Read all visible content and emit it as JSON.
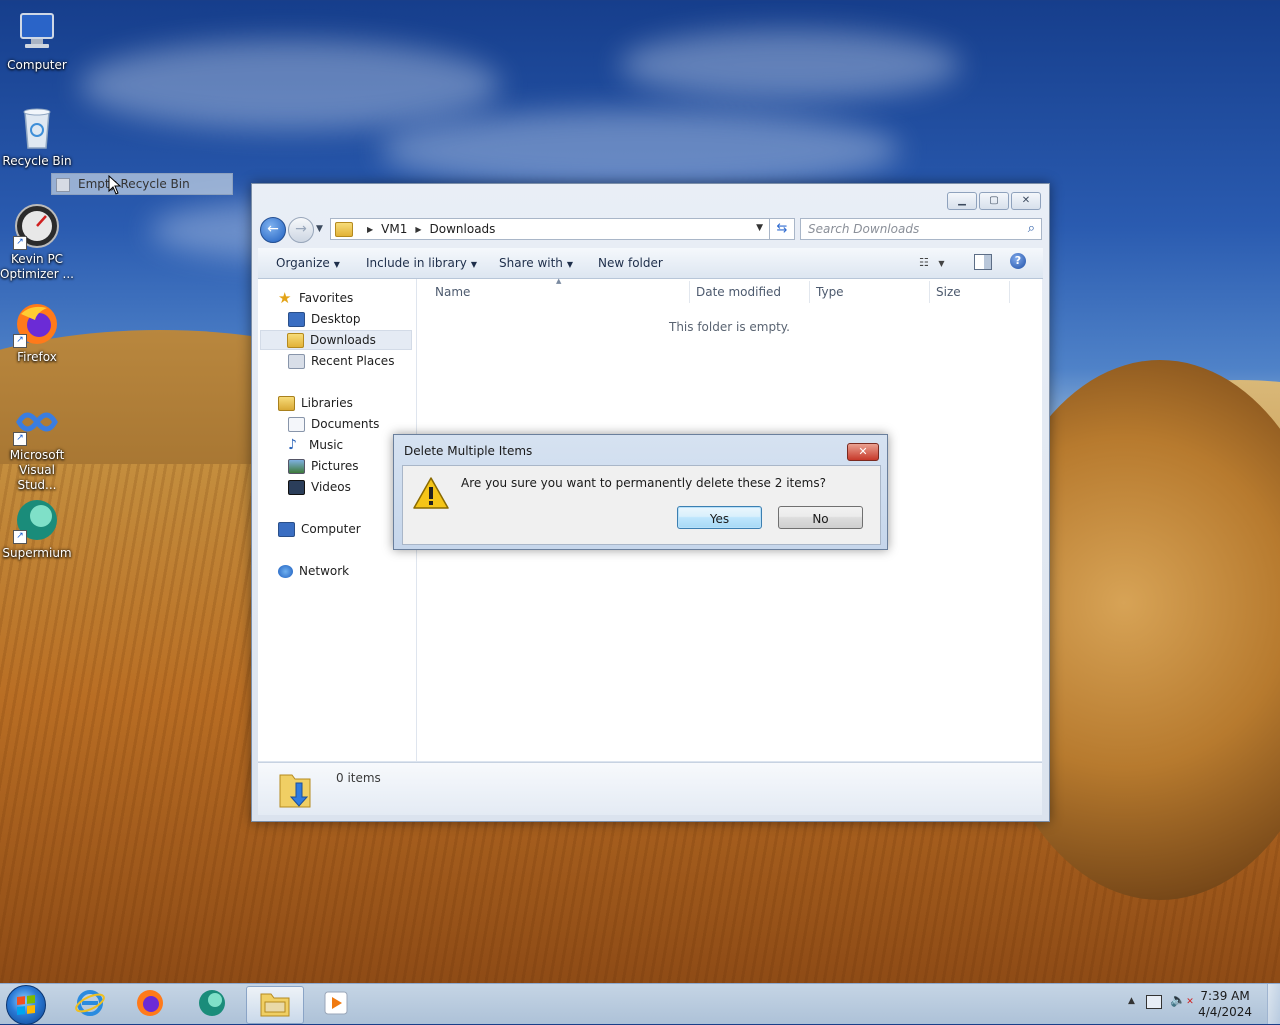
{
  "desktop": {
    "icons": [
      {
        "label": "Computer"
      },
      {
        "label": "Recycle Bin"
      },
      {
        "label": "Kevin PC Optimizer ..."
      },
      {
        "label": "Firefox"
      },
      {
        "label": "Microsoft Visual Stud..."
      },
      {
        "label": "Supermium"
      }
    ],
    "drag_label": "Empty Recycle Bin"
  },
  "explorer": {
    "breadcrumb": [
      "VM1",
      "Downloads"
    ],
    "search_placeholder": "Search Downloads",
    "toolbar": {
      "organize": "Organize",
      "include_in_library": "Include in library",
      "share_with": "Share with",
      "new_folder": "New folder"
    },
    "nav": {
      "favorites": "Favorites",
      "desktop": "Desktop",
      "downloads": "Downloads",
      "recent_places": "Recent Places",
      "libraries": "Libraries",
      "documents": "Documents",
      "music": "Music",
      "pictures": "Pictures",
      "videos": "Videos",
      "computer": "Computer",
      "network": "Network"
    },
    "columns": {
      "name": "Name",
      "date_modified": "Date modified",
      "type": "Type",
      "size": "Size"
    },
    "empty_message": "This folder is empty.",
    "item_count": "0 items"
  },
  "dialog": {
    "title": "Delete Multiple Items",
    "message": "Are you sure you want to permanently delete these 2 items?",
    "yes": "Yes",
    "no": "No"
  },
  "taskbar": {
    "apps": [
      "internet-explorer",
      "firefox",
      "supermium",
      "windows-explorer",
      "media-player"
    ],
    "time": "7:39 AM",
    "date": "4/4/2024"
  }
}
